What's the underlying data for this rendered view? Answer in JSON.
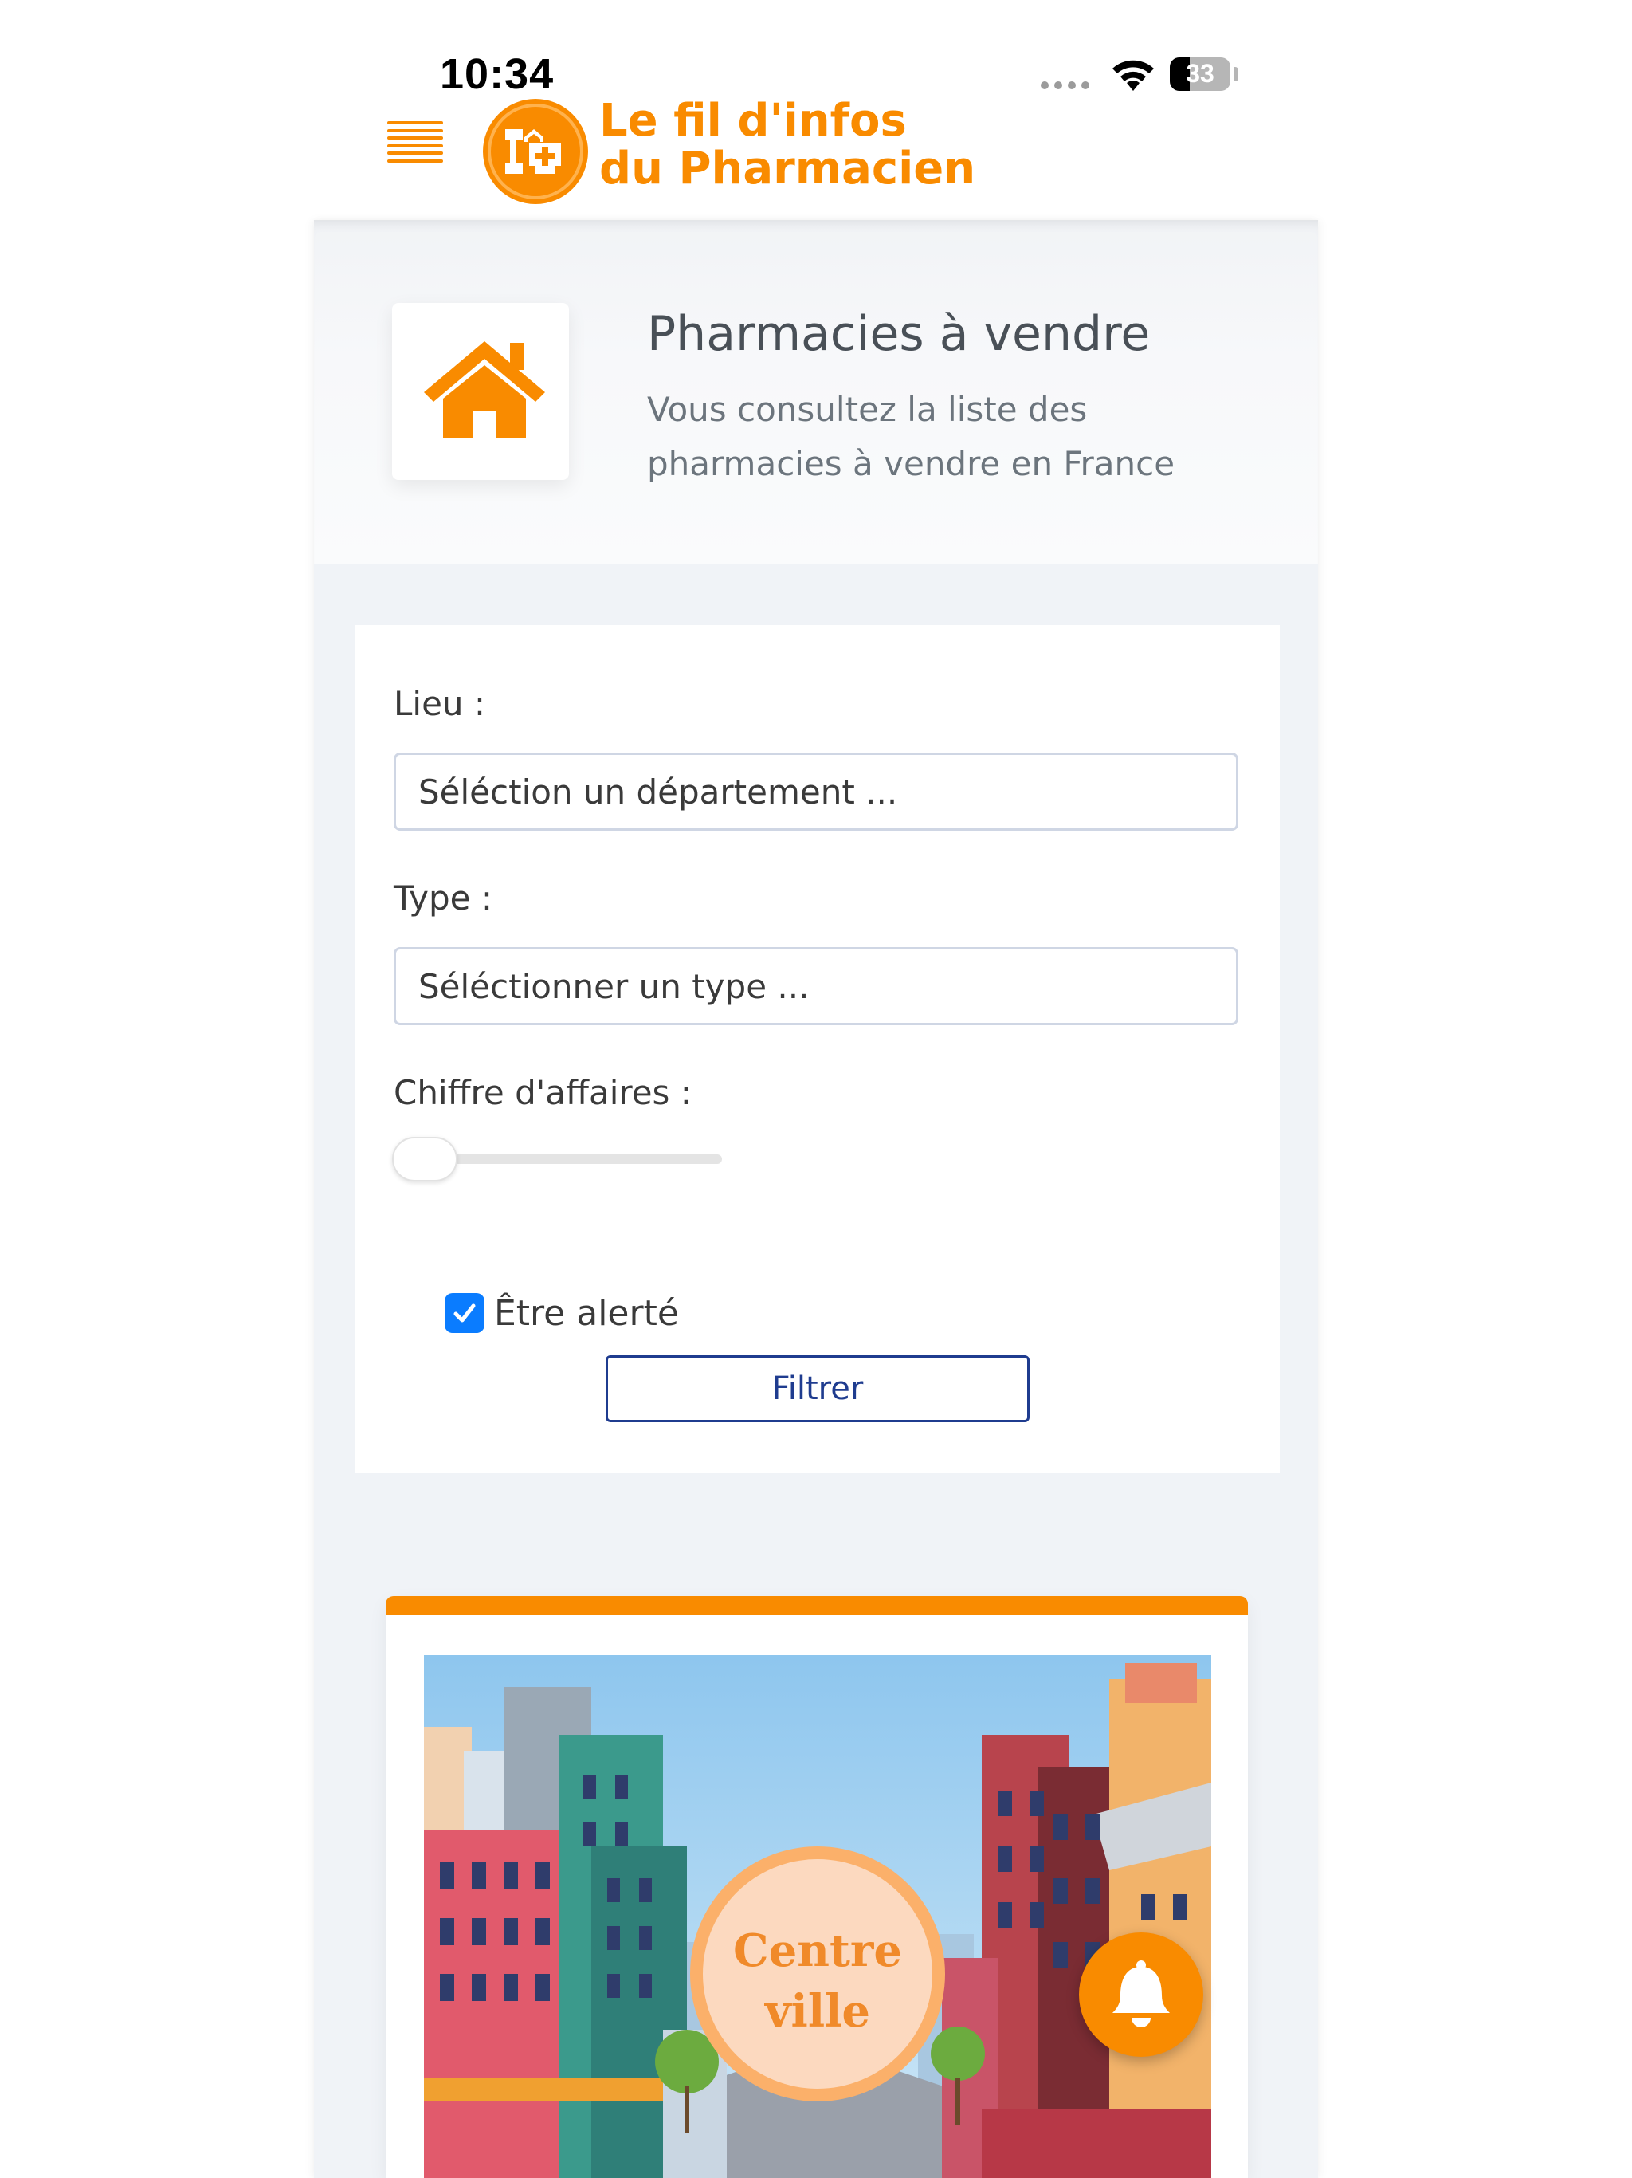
{
  "status_bar": {
    "time": "10:34",
    "battery_level": "33",
    "battery_fraction": 0.33
  },
  "header": {
    "logo_line1": "Le fil d'infos",
    "logo_line2": "du Pharmacien",
    "brand_color": "#f98b00"
  },
  "page": {
    "title": "Pharmacies à vendre",
    "subtitle": "Vous consultez la liste des pharmacies à vendre en France",
    "icon": "home-icon"
  },
  "filters": {
    "lieu_label": "Lieu :",
    "lieu_placeholder": "Séléction un département ...",
    "type_label": "Type :",
    "type_placeholder": "Séléctionner un type ...",
    "ca_label": "Chiffre d'affaires :",
    "ca_slider_fraction": 0,
    "alert_label": "Être alerté",
    "alert_checked": true,
    "filter_button": "Filtrer"
  },
  "listing": {
    "image_caption_line1": "Centre",
    "image_caption_line2": "ville",
    "accent_color": "#f98b00"
  },
  "fab": {
    "icon": "bell-icon"
  }
}
